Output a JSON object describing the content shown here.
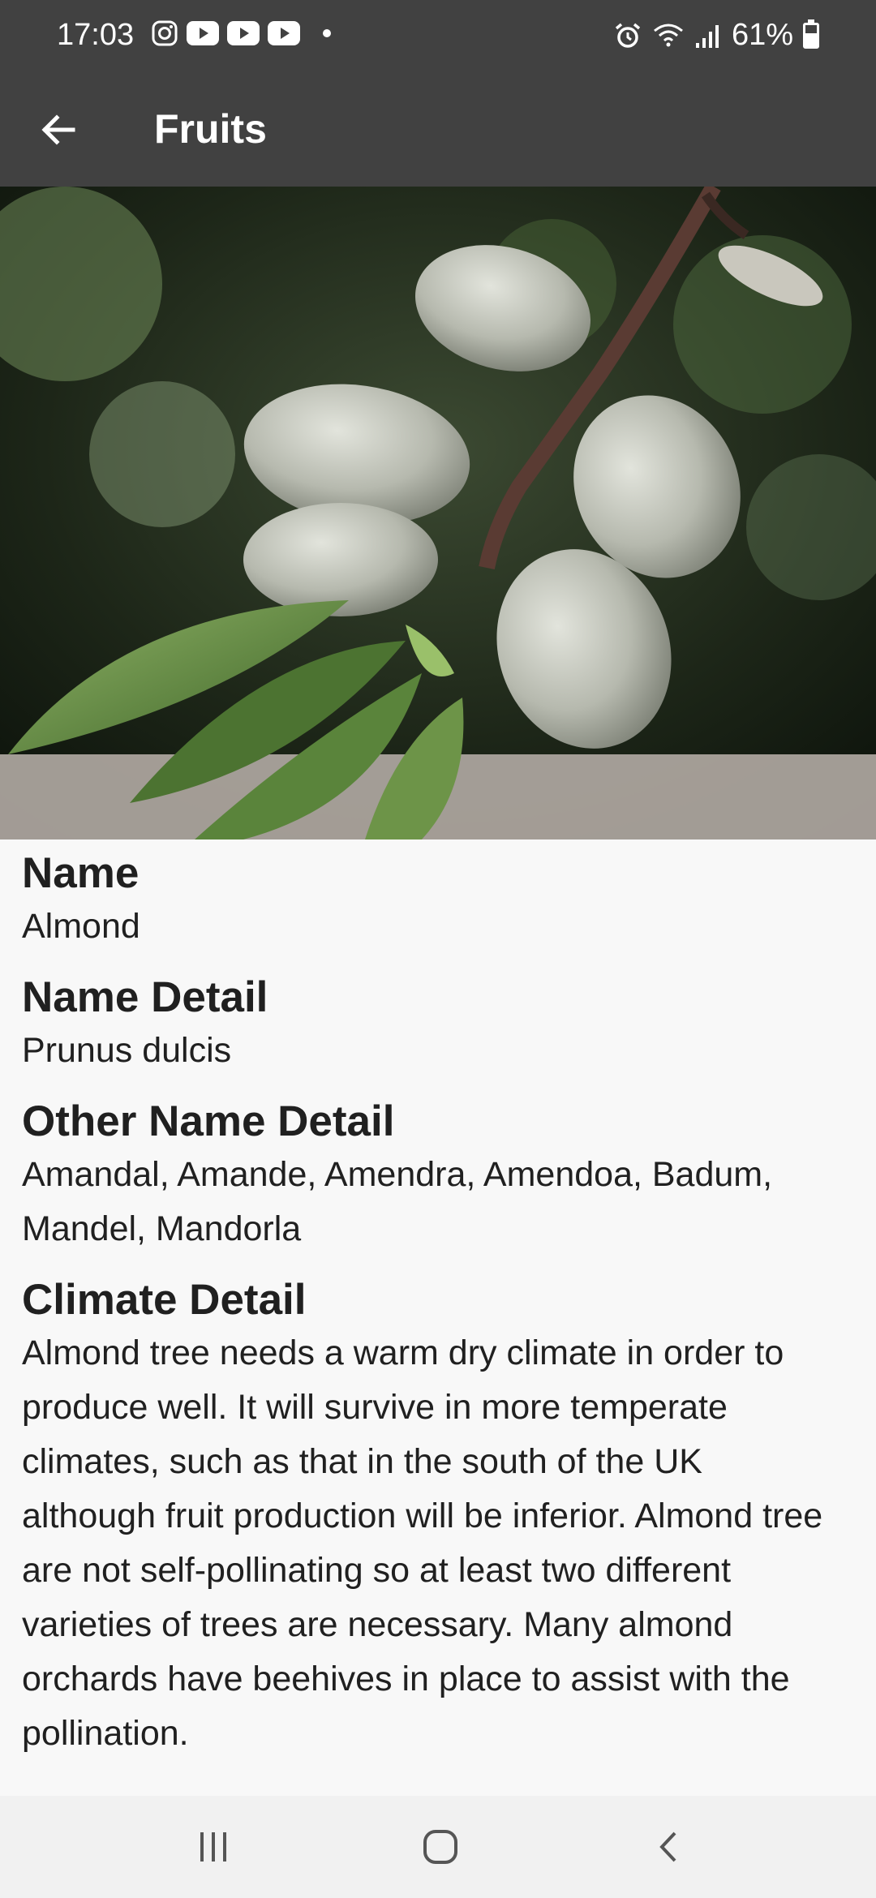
{
  "status_bar": {
    "time": "17:03",
    "battery": "61%",
    "battery_level": 0.61,
    "left_icons": [
      "instagram-icon",
      "youtube-icon",
      "youtube-icon",
      "youtube-icon",
      "dot-icon"
    ],
    "right_icons": [
      "alarm-icon",
      "wifi-icon",
      "signal-icon",
      "battery-icon"
    ]
  },
  "app_bar": {
    "title": "Fruits",
    "back_icon": "arrow-left-icon"
  },
  "hero_image": {
    "description_icon": "almond-photo"
  },
  "sections": [
    {
      "title": "Name",
      "value": "Almond"
    },
    {
      "title": "Name Detail",
      "value": "Prunus dulcis"
    },
    {
      "title": "Other Name Detail",
      "value": "Amandal, Amande, Amendra, Amendoa, Badum, Mandel, Mandorla"
    },
    {
      "title": "Climate Detail",
      "value": "Almond tree needs a warm dry climate in order to produce well. It will survive in more temperate climates, such as that in the south of the UK although fruit production will be inferior.  Almond tree are not self-pollinating so at least two different varieties of trees are necessary. Many almond orchards have beehives in place to assist with the pollination."
    }
  ],
  "nav_bar": {
    "icons": [
      "recent-apps-icon",
      "home-icon",
      "back-icon"
    ]
  },
  "colors": {
    "app_bar": "#414141",
    "background": "#f8f8f8",
    "text": "#202020"
  }
}
